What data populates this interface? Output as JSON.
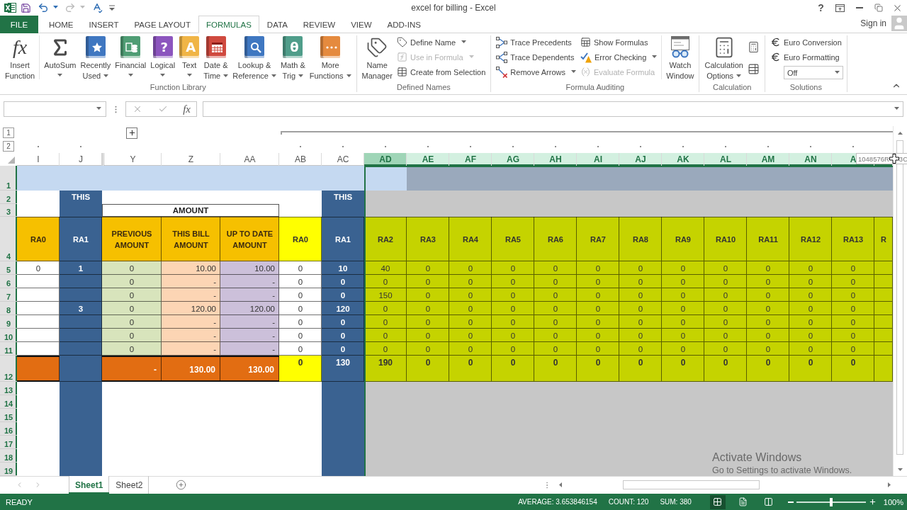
{
  "window": {
    "title": "excel for billing - Excel",
    "help": "?"
  },
  "quick_access": [
    {
      "kind": "save",
      "disabled": false
    },
    {
      "kind": "undo",
      "disabled": false
    },
    {
      "kind": "redo",
      "disabled": true
    },
    {
      "kind": "spelling",
      "disabled": false
    },
    {
      "kind": "customize",
      "disabled": false
    }
  ],
  "tabs": [
    {
      "kind": "file",
      "label": "FILE",
      "selected": false
    },
    {
      "kind": "tab",
      "label": "HOME",
      "selected": false
    },
    {
      "kind": "tab",
      "label": "INSERT",
      "selected": false
    },
    {
      "kind": "tab",
      "label": "PAGE LAYOUT",
      "selected": false
    },
    {
      "kind": "tab",
      "label": "FORMULAS",
      "selected": true
    },
    {
      "kind": "tab",
      "label": "DATA",
      "selected": false
    },
    {
      "kind": "tab",
      "label": "REVIEW",
      "selected": false
    },
    {
      "kind": "tab",
      "label": "VIEW",
      "selected": false
    },
    {
      "kind": "tab",
      "label": "ADD-INS",
      "selected": false
    }
  ],
  "account": {
    "label": "Sign in"
  },
  "ribbon": {
    "groups": [
      {
        "label": "Function Library",
        "columns": [
          [
            {
              "kind": "insert_function",
              "glyph": "fx",
              "label": "Insert\nFunction",
              "dropdown": false,
              "disabled": false
            }
          ],
          [
            {
              "kind": "autosum",
              "label": "AutoSum",
              "dropdown": true,
              "disabled": false
            }
          ],
          [
            {
              "kind": "recently_used",
              "label": "Recently\nUsed",
              "dropdown": true,
              "disabled": false
            }
          ],
          [
            {
              "kind": "financial",
              "label": "Financial",
              "dropdown": true,
              "disabled": false
            }
          ],
          [
            {
              "kind": "logical",
              "glyph": "?",
              "label": "Logical",
              "dropdown": true,
              "disabled": false
            }
          ],
          [
            {
              "kind": "text_functions",
              "glyph": "A",
              "label": "Text",
              "dropdown": true,
              "disabled": false
            }
          ],
          [
            {
              "kind": "date_time",
              "label": "Date &\nTime",
              "dropdown": true,
              "disabled": false
            }
          ],
          [
            {
              "kind": "lookup_reference",
              "label": "Lookup &\nReference",
              "dropdown": true,
              "disabled": false
            }
          ],
          [
            {
              "kind": "math_trig",
              "glyph": "θ",
              "label": "Math &\nTrig",
              "dropdown": true,
              "disabled": false
            }
          ],
          [
            {
              "kind": "more_functions",
              "label": "More\nFunctions",
              "dropdown": true,
              "disabled": false
            }
          ]
        ]
      },
      {
        "label": "Defined Names",
        "columns": [
          [
            {
              "kind": "name_manager",
              "label": "Name\nManager",
              "dropdown": false,
              "disabled": false
            }
          ],
          [
            {
              "kind": "define_name",
              "label": "Define Name",
              "dropdown": true,
              "disabled": false
            },
            {
              "kind": "use_in_formula",
              "label": "Use in Formula",
              "dropdown": true,
              "disabled": true
            },
            {
              "kind": "create_from_selection",
              "label": "Create from Selection",
              "dropdown": false,
              "disabled": false
            }
          ]
        ]
      },
      {
        "label": "Formula Auditing",
        "columns": [
          [
            {
              "kind": "trace_precedents",
              "label": "Trace Precedents",
              "dropdown": false,
              "disabled": false
            },
            {
              "kind": "trace_dependents",
              "label": "Trace Dependents",
              "dropdown": false,
              "disabled": false
            },
            {
              "kind": "remove_arrows",
              "label": "Remove Arrows",
              "dropdown": true,
              "disabled": false
            }
          ],
          [
            {
              "kind": "show_formulas",
              "label": "Show Formulas",
              "dropdown": false,
              "disabled": false
            },
            {
              "kind": "error_checking",
              "label": "Error Checking",
              "dropdown": true,
              "disabled": false
            },
            {
              "kind": "evaluate_formula",
              "label": "Evaluate Formula",
              "dropdown": false,
              "disabled": true
            }
          ],
          [
            {
              "kind": "watch_window",
              "label": "Watch\nWindow",
              "dropdown": false,
              "disabled": false
            }
          ]
        ]
      },
      {
        "label": "Calculation",
        "columns": [
          [
            {
              "kind": "calculation_options",
              "label": "Calculation\nOptions",
              "dropdown": true,
              "disabled": false
            }
          ],
          [
            {
              "kind": "calculate_now",
              "dropdown": false,
              "disabled": false
            },
            {
              "kind": "calculate_sheet",
              "dropdown": false,
              "disabled": false
            }
          ]
        ]
      },
      {
        "label": "Solutions",
        "columns": [
          [
            {
              "kind": "euro_conversion",
              "label": "Euro Conversion",
              "dropdown": false,
              "disabled": false
            },
            {
              "kind": "euro_formatting",
              "label": "Euro Formatting",
              "dropdown": false,
              "disabled": false
            },
            {
              "kind": "select",
              "value": "Off",
              "dropdown": true,
              "disabled": false
            }
          ]
        ]
      }
    ]
  },
  "formula_bar": {
    "glyph": "fx"
  },
  "outline": {
    "levels": [
      "1",
      "2"
    ]
  },
  "sheet": {
    "amount_title": "AMOUNT",
    "rows": [
      {
        "label": "1",
        "selected": true
      },
      {
        "label": "2",
        "selected": true
      },
      {
        "label": "3",
        "selected": true
      },
      {
        "label": "4",
        "selected": true
      },
      {
        "label": "5",
        "selected": true
      },
      {
        "label": "6",
        "selected": true
      },
      {
        "label": "7",
        "selected": true
      },
      {
        "label": "8",
        "selected": true
      },
      {
        "label": "9",
        "selected": true
      },
      {
        "label": "10",
        "selected": true
      },
      {
        "label": "11",
        "selected": true
      },
      {
        "label": "12",
        "selected": true
      },
      {
        "label": "13",
        "selected": true
      },
      {
        "label": "14",
        "selected": true
      },
      {
        "label": "15",
        "selected": true
      },
      {
        "label": "16",
        "selected": true
      },
      {
        "label": "17",
        "selected": true
      },
      {
        "label": "18",
        "selected": true
      },
      {
        "label": "19",
        "selected": true
      }
    ],
    "columns": [
      {
        "letter": "I",
        "selected": false,
        "active": false,
        "grouped": false,
        "outline_marker": true,
        "hidden_before": false,
        "kind": "ra_index",
        "header": "RA0",
        "cells": [
          "0",
          null,
          null,
          null,
          null,
          null,
          null
        ]
      },
      {
        "letter": "J",
        "selected": false,
        "active": false,
        "grouped": false,
        "outline_marker": true,
        "hidden_before": false,
        "kind": "ra_current",
        "banner": "THIS",
        "header": "RA1",
        "cells": [
          "1",
          null,
          null,
          "3",
          null,
          null,
          null
        ]
      },
      {
        "letter": "Y",
        "selected": false,
        "active": false,
        "grouped": false,
        "outline_marker": false,
        "hidden_before": true,
        "kind": "previous",
        "header": "PREVIOUS AMOUNT",
        "cells": [
          "0",
          "0",
          "0",
          "0",
          "0",
          "0",
          "0"
        ],
        "total": "-"
      },
      {
        "letter": "Z",
        "selected": false,
        "active": false,
        "grouped": false,
        "outline_marker": false,
        "hidden_before": false,
        "kind": "this_bill",
        "header": "THIS BILL AMOUNT",
        "cells": [
          "10.00",
          "-",
          "-",
          "120.00",
          "-",
          "-",
          "-"
        ],
        "total": "130.00"
      },
      {
        "letter": "AA",
        "selected": false,
        "active": false,
        "grouped": false,
        "outline_marker": false,
        "hidden_before": false,
        "kind": "up_to_date",
        "header": "UP TO DATE AMOUNT",
        "cells": [
          "10.00",
          "-",
          "-",
          "120.00",
          "-",
          "-",
          "-"
        ],
        "total": "130.00"
      },
      {
        "letter": "AB",
        "selected": false,
        "active": false,
        "grouped": true,
        "outline_marker": true,
        "hidden_before": false,
        "kind": "ra_sum",
        "header": "RA0",
        "cells": [
          "0",
          "0",
          "0",
          "0",
          "0",
          "0",
          "0"
        ],
        "total": "0"
      },
      {
        "letter": "AC",
        "selected": false,
        "active": false,
        "grouped": true,
        "outline_marker": true,
        "hidden_before": false,
        "kind": "ra_current",
        "banner": "THIS",
        "header": "RA1",
        "cells": [
          "10",
          "0",
          "0",
          "120",
          "0",
          "0",
          "0"
        ],
        "total": "130"
      },
      {
        "letter": "AD",
        "selected": true,
        "active": true,
        "grouped": true,
        "outline_marker": true,
        "hidden_before": false,
        "kind": "ra_more",
        "header": "RA2",
        "cells": [
          "40",
          "0",
          "150",
          "0",
          "0",
          "0",
          "0"
        ],
        "total": "190"
      },
      {
        "letter": "AE",
        "selected": true,
        "active": false,
        "grouped": true,
        "outline_marker": true,
        "hidden_before": false,
        "kind": "ra_more",
        "header": "RA3",
        "cells": [
          "0",
          "0",
          "0",
          "0",
          "0",
          "0",
          "0"
        ],
        "total": "0"
      },
      {
        "letter": "AF",
        "selected": true,
        "active": false,
        "grouped": true,
        "outline_marker": true,
        "hidden_before": false,
        "kind": "ra_more",
        "header": "RA4",
        "cells": [
          "0",
          "0",
          "0",
          "0",
          "0",
          "0",
          "0"
        ],
        "total": "0"
      },
      {
        "letter": "AG",
        "selected": true,
        "active": false,
        "grouped": true,
        "outline_marker": true,
        "hidden_before": false,
        "kind": "ra_more",
        "header": "RA5",
        "cells": [
          "0",
          "0",
          "0",
          "0",
          "0",
          "0",
          "0"
        ],
        "total": "0"
      },
      {
        "letter": "AH",
        "selected": true,
        "active": false,
        "grouped": true,
        "outline_marker": true,
        "hidden_before": false,
        "kind": "ra_more",
        "header": "RA6",
        "cells": [
          "0",
          "0",
          "0",
          "0",
          "0",
          "0",
          "0"
        ],
        "total": "0"
      },
      {
        "letter": "AI",
        "selected": true,
        "active": false,
        "grouped": true,
        "outline_marker": true,
        "hidden_before": false,
        "kind": "ra_more",
        "header": "RA7",
        "cells": [
          "0",
          "0",
          "0",
          "0",
          "0",
          "0",
          "0"
        ],
        "total": "0"
      },
      {
        "letter": "AJ",
        "selected": true,
        "active": false,
        "grouped": true,
        "outline_marker": true,
        "hidden_before": false,
        "kind": "ra_more",
        "header": "RA8",
        "cells": [
          "0",
          "0",
          "0",
          "0",
          "0",
          "0",
          "0"
        ],
        "total": "0"
      },
      {
        "letter": "AK",
        "selected": true,
        "active": false,
        "grouped": true,
        "outline_marker": true,
        "hidden_before": false,
        "kind": "ra_more",
        "header": "RA9",
        "cells": [
          "0",
          "0",
          "0",
          "0",
          "0",
          "0",
          "0"
        ],
        "total": "0"
      },
      {
        "letter": "AL",
        "selected": true,
        "active": false,
        "grouped": true,
        "outline_marker": true,
        "hidden_before": false,
        "kind": "ra_more",
        "header": "RA10",
        "cells": [
          "0",
          "0",
          "0",
          "0",
          "0",
          "0",
          "0"
        ],
        "total": "0"
      },
      {
        "letter": "AM",
        "selected": true,
        "active": false,
        "grouped": true,
        "outline_marker": true,
        "hidden_before": false,
        "kind": "ra_more",
        "header": "RA11",
        "cells": [
          "0",
          "0",
          "0",
          "0",
          "0",
          "0",
          "0"
        ],
        "total": "0"
      },
      {
        "letter": "AN",
        "selected": true,
        "active": false,
        "grouped": true,
        "outline_marker": true,
        "hidden_before": false,
        "kind": "ra_more",
        "header": "RA12",
        "cells": [
          "0",
          "0",
          "0",
          "0",
          "0",
          "0",
          "0"
        ],
        "total": "0"
      },
      {
        "letter": "A",
        "selected": true,
        "active": false,
        "grouped": true,
        "outline_marker": true,
        "hidden_before": false,
        "kind": "ra_more",
        "header": "RA13",
        "cells": [
          "0",
          "0",
          "0",
          "0",
          "0",
          "0",
          "0"
        ],
        "total": "0"
      },
      {
        "selected": true,
        "active": false,
        "grouped": true,
        "outline_marker": false,
        "hidden_before": false,
        "kind": "ra_more",
        "header": "R"
      }
    ]
  },
  "sheet_tabs": [
    {
      "label": "Sheet1",
      "selected": true
    },
    {
      "label": "Sheet2",
      "selected": false
    }
  ],
  "tooltip": {
    "rows": "1048576R",
    "columns": "3C"
  },
  "activation_notice": {
    "title": "Activate Windows",
    "text": "Go to Settings to activate Windows."
  },
  "status_bar": {
    "mode": "READY",
    "stats": [
      "AVERAGE: 3.653846154",
      "COUNT: 120",
      "SUM: 380"
    ],
    "views": [
      {
        "kind": "normal",
        "selected": true
      },
      {
        "kind": "page_layout",
        "selected": false
      },
      {
        "kind": "page_break",
        "selected": false
      }
    ],
    "zoom": {
      "level": 0.5,
      "reading": "100%"
    }
  }
}
